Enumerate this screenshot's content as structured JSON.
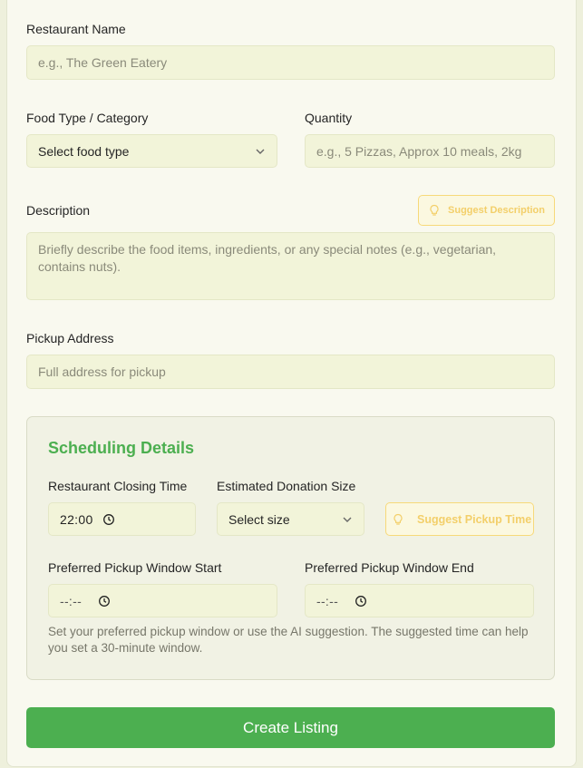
{
  "form": {
    "restaurant_name": {
      "label": "Restaurant Name",
      "placeholder": "e.g., The Green Eatery",
      "value": ""
    },
    "food_type": {
      "label": "Food Type / Category",
      "selected": "Select food type"
    },
    "quantity": {
      "label": "Quantity",
      "placeholder": "e.g., 5 Pizzas, Approx 10 meals, 2kg"
    },
    "description": {
      "label": "Description",
      "suggest_label": "Suggest Description",
      "placeholder": "Briefly describe the food items, ingredients, or any special notes (e.g., vegetarian, contains nuts)."
    },
    "pickup_address": {
      "label": "Pickup Address",
      "placeholder": "Full address for pickup"
    }
  },
  "scheduling": {
    "title": "Scheduling Details",
    "closing_time": {
      "label": "Restaurant Closing Time",
      "value": "22:00"
    },
    "donation_size": {
      "label": "Estimated Donation Size",
      "selected": "Select size"
    },
    "suggest_pickup_label": "Suggest Pickup Time",
    "window_start": {
      "label": "Preferred Pickup Window Start",
      "value": "--:--"
    },
    "window_end": {
      "label": "Preferred Pickup Window End",
      "value": "--:--"
    },
    "help_text": "Set your preferred pickup window or use the AI suggestion. The suggested time can help you set a 30-minute window."
  },
  "submit_label": "Create Listing",
  "colors": {
    "accent": "#4caf50",
    "ai_button": "#f3cf6a",
    "field_bg": "#f2f4d9"
  },
  "icons": {
    "select_arrow": "chevron-down-icon",
    "time": "clock-icon",
    "ai_suggest": "lightbulb-icon"
  }
}
